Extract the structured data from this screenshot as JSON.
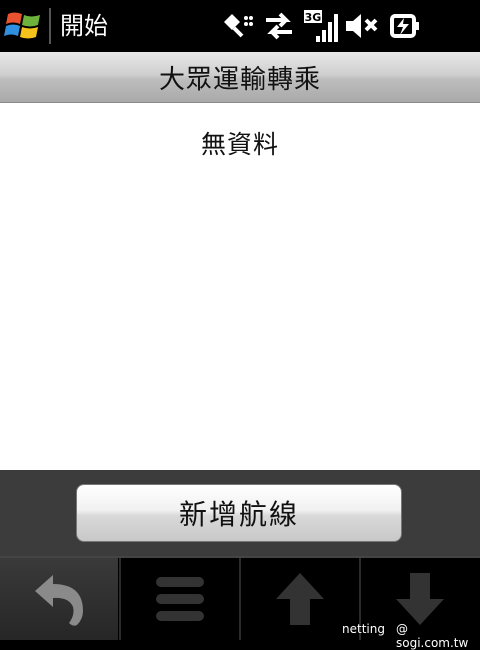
{
  "statusbar": {
    "start_label": "開始",
    "network_badge": "3G",
    "icons": [
      "windows-logo-icon",
      "data-off-icon",
      "data-transfer-icon",
      "signal-3g-icon",
      "volume-mute-icon",
      "battery-charging-icon"
    ]
  },
  "titlebar": {
    "title": "大眾運輸轉乘"
  },
  "content": {
    "empty_message": "無資料"
  },
  "actions": {
    "add_route_label": "新增航線"
  },
  "toolbar": {
    "buttons": [
      "back-icon",
      "menu-icon",
      "up-arrow-icon",
      "down-arrow-icon"
    ]
  },
  "watermark": {
    "left": "netting",
    "right": "@ sogi.com.tw"
  },
  "colors": {
    "accent_bg": "#3c3c3c",
    "title_gradient_top": "#e8e8e8",
    "title_gradient_bottom": "#a9a9a9"
  }
}
